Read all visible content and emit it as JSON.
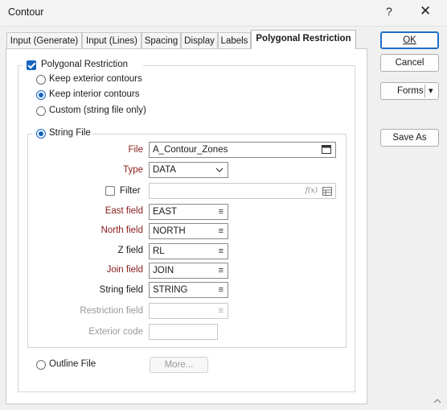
{
  "window": {
    "title": "Contour",
    "help_glyph": "?",
    "close_glyph": "✕"
  },
  "tabs": [
    {
      "label": "Input (Generate)"
    },
    {
      "label": "Input (Lines)"
    },
    {
      "label": "Spacing"
    },
    {
      "label": "Display"
    },
    {
      "label": "Labels"
    },
    {
      "label": "Polygonal Restriction",
      "active": true
    }
  ],
  "side_buttons": {
    "ok": "OK",
    "cancel": "Cancel",
    "forms": "Forms",
    "forms_arrow": "▾",
    "save_as": "Save As"
  },
  "polygonal": {
    "label": "Polygonal Restriction",
    "checked": true,
    "options": [
      {
        "label": "Keep exterior contours",
        "selected": false
      },
      {
        "label": "Keep interior contours",
        "selected": true
      },
      {
        "label": "Custom (string file only)",
        "selected": false
      }
    ]
  },
  "string_file": {
    "label": "String File",
    "selected": true,
    "file_label": "File",
    "file_value": "A_Contour_Zones",
    "type_label": "Type",
    "type_value": "DATA",
    "filter_label": "Filter",
    "filter_value": "",
    "fx_glyph": "f(x)",
    "fields": [
      {
        "label": "East field",
        "value": "EAST",
        "required": true
      },
      {
        "label": "North field",
        "value": "NORTH",
        "required": true
      },
      {
        "label": "Z field",
        "value": "RL",
        "required": false
      },
      {
        "label": "Join field",
        "value": "JOIN",
        "required": true
      },
      {
        "label": "String field",
        "value": "STRING",
        "required": false
      }
    ],
    "restriction_label": "Restriction field",
    "restriction_value": "",
    "exterior_label": "Exterior code",
    "exterior_value": ""
  },
  "outline": {
    "label": "Outline File",
    "selected": false,
    "more": "More..."
  },
  "colors": {
    "accent": "#1565c0",
    "required_label": "#8b1a1a"
  }
}
